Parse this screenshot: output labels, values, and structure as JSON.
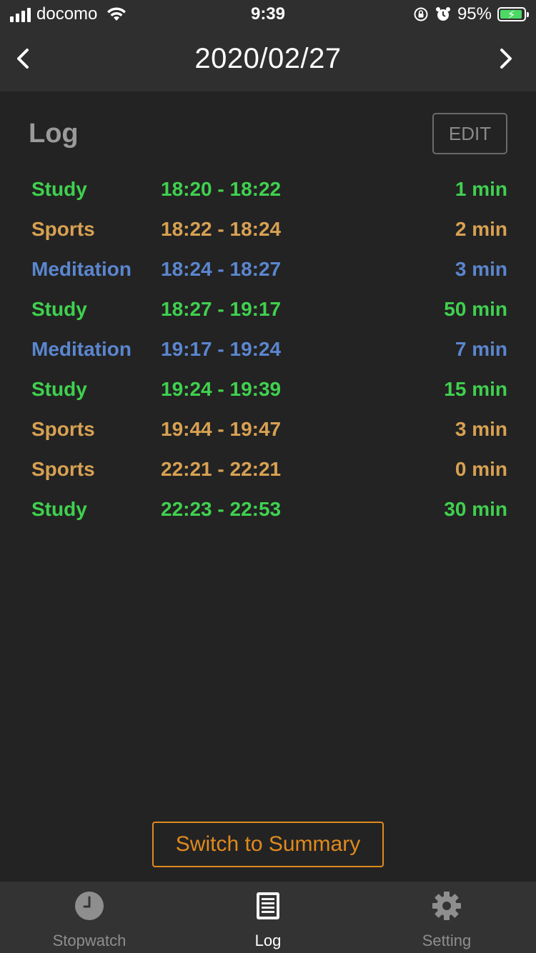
{
  "status_bar": {
    "carrier": "docomo",
    "time": "9:39",
    "battery": "95%",
    "battery_level": 0.95
  },
  "header": {
    "title": "2020/02/27",
    "prev_icon": "chevron-left-icon",
    "next_icon": "chevron-right-icon"
  },
  "log": {
    "title": "Log",
    "edit_label": "EDIT",
    "colors": {
      "Study": "#3fd14f",
      "Sports": "#d8a152",
      "Meditation": "#5b86cf"
    },
    "entries": [
      {
        "activity": "Study",
        "range": "18:20 - 18:22",
        "duration": "1 min"
      },
      {
        "activity": "Sports",
        "range": "18:22 - 18:24",
        "duration": "2 min"
      },
      {
        "activity": "Meditation",
        "range": "18:24 - 18:27",
        "duration": "3 min"
      },
      {
        "activity": "Study",
        "range": "18:27 - 19:17",
        "duration": "50 min"
      },
      {
        "activity": "Meditation",
        "range": "19:17 - 19:24",
        "duration": "7 min"
      },
      {
        "activity": "Study",
        "range": "19:24 - 19:39",
        "duration": "15 min"
      },
      {
        "activity": "Sports",
        "range": "19:44 - 19:47",
        "duration": "3 min"
      },
      {
        "activity": "Sports",
        "range": "22:21 - 22:21",
        "duration": "0 min"
      },
      {
        "activity": "Study",
        "range": "22:23 - 22:53",
        "duration": "30 min"
      }
    ]
  },
  "switch_button": {
    "label": "Switch to Summary",
    "color": "#e08a1e"
  },
  "tabs": [
    {
      "label": "Stopwatch",
      "icon": "clock-icon",
      "active": false
    },
    {
      "label": "Log",
      "icon": "document-list-icon",
      "active": true
    },
    {
      "label": "Setting",
      "icon": "gear-icon",
      "active": false
    }
  ]
}
